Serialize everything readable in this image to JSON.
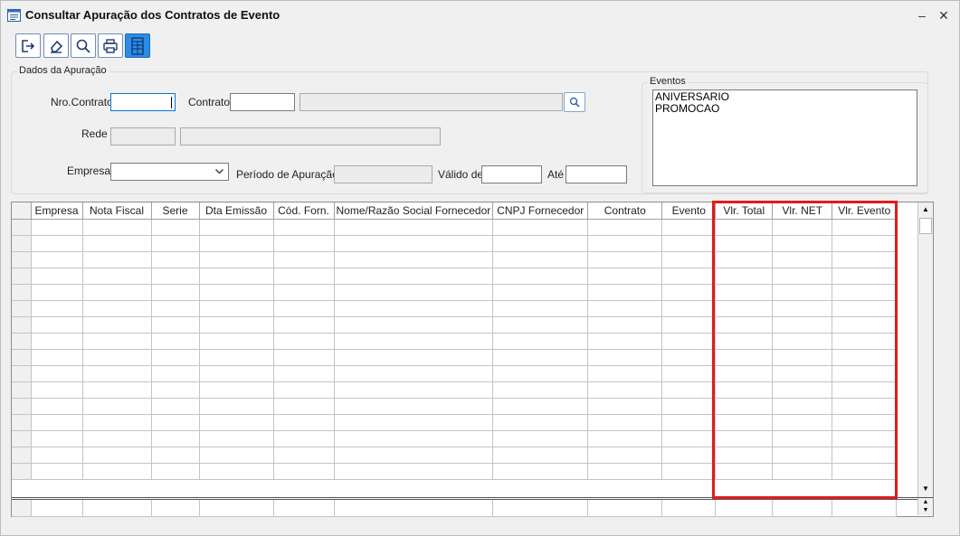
{
  "window": {
    "title": "Consultar Apuração dos Contratos de Evento",
    "minimize": "–",
    "close": "✕"
  },
  "toolbar": {
    "buttons": [
      {
        "name": "exit",
        "icon": "exit-icon"
      },
      {
        "name": "clear",
        "icon": "eraser-icon"
      },
      {
        "name": "search",
        "icon": "search-icon"
      },
      {
        "name": "print",
        "icon": "printer-icon"
      },
      {
        "name": "grid",
        "icon": "grid-icon",
        "active": true
      }
    ]
  },
  "apuracao": {
    "legend": "Dados da Apuração",
    "nro_contrato_label": "Nro.Contrato",
    "nro_contrato_value": "",
    "contrato_label": "Contrato",
    "contrato_value": "",
    "contrato_desc": "",
    "rede_label": "Rede",
    "rede_code": "",
    "rede_desc": "",
    "empresa_label": "Empresa",
    "empresa_value": "",
    "periodo_label": "Período de Apuração",
    "periodo_value": "",
    "valido_de_label": "Válido de",
    "valido_de_value": "",
    "ate_label": "Até",
    "ate_value": ""
  },
  "eventos": {
    "legend": "Eventos",
    "items": [
      "ANIVERSARIO",
      "PROMOCAO"
    ]
  },
  "grid": {
    "columns": [
      "Empresa",
      "Nota Fiscal",
      "Serie",
      "Dta Emissão",
      "Cód. Forn.",
      "Nome/Razão Social Fornecedor",
      "CNPJ Fornecedor",
      "Contrato",
      "Evento",
      "Vlr. Total",
      "Vlr. NET",
      "Vlr. Evento"
    ],
    "row_count": 16
  },
  "colors": {
    "highlight": "#e01b1b",
    "accent_button": "#2b8ce8"
  }
}
